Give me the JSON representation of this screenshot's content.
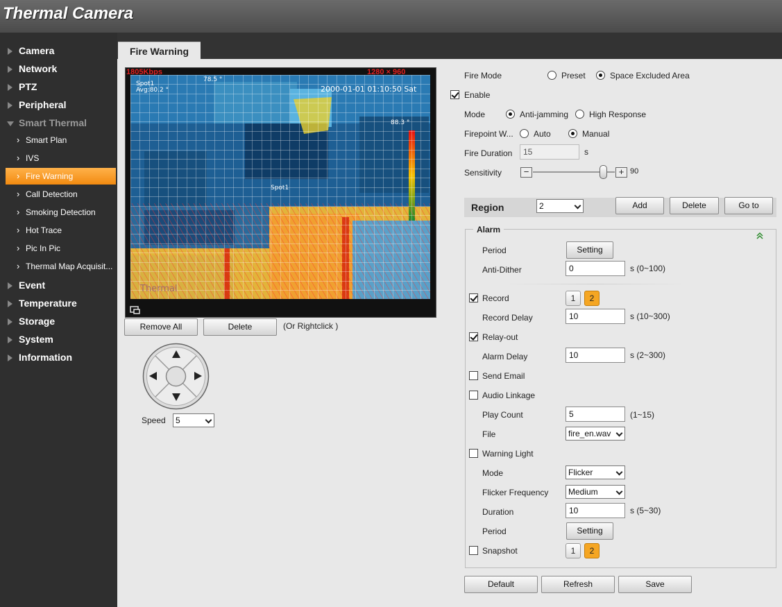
{
  "app": {
    "title": "Thermal Camera"
  },
  "sidebar": {
    "items": [
      {
        "label": "Camera"
      },
      {
        "label": "Network"
      },
      {
        "label": "PTZ"
      },
      {
        "label": "Peripheral"
      },
      {
        "label": "Smart Thermal"
      },
      {
        "label": "Event"
      },
      {
        "label": "Temperature"
      },
      {
        "label": "Storage"
      },
      {
        "label": "System"
      },
      {
        "label": "Information"
      }
    ],
    "sub_items": [
      {
        "label": "Smart Plan"
      },
      {
        "label": "IVS"
      },
      {
        "label": "Fire Warning"
      },
      {
        "label": "Call Detection"
      },
      {
        "label": "Smoking Detection"
      },
      {
        "label": "Hot Trace"
      },
      {
        "label": "Pic In Pic"
      },
      {
        "label": "Thermal Map Acquisit..."
      }
    ]
  },
  "tab": {
    "label": "Fire Warning"
  },
  "video": {
    "bitrate": "1805Kbps",
    "resolution": "1280 × 960",
    "datetime": "2000-01-01 01:10:50 Sat",
    "spot_label": "Spot1",
    "avg_label": "Avg:80.2 ° ",
    "temp_a": "78.5 °",
    "temp_b": "88.3 °",
    "spot_center": "Spot1",
    "watermark": "Thermal"
  },
  "video_controls": {
    "remove_all": "Remove All",
    "delete": "Delete",
    "hint": "(Or Rightclick )"
  },
  "ptz": {
    "speed_label": "Speed",
    "speed_value": "5"
  },
  "form": {
    "fire_mode_label": "Fire Mode",
    "fire_mode_options": [
      "Preset",
      "Space Excluded Area"
    ],
    "fire_mode_selected": "Space Excluded Area",
    "enable_label": "Enable",
    "enable": true,
    "mode_label": "Mode",
    "mode_options": [
      "Anti-jamming",
      "High Response"
    ],
    "mode_selected": "Anti-jamming",
    "firepoint_label": "Firepoint W...",
    "firepoint_options": [
      "Auto",
      "Manual"
    ],
    "firepoint_selected": "Manual",
    "duration_label": "Fire Duration",
    "duration_value": "15",
    "duration_unit": "s",
    "sensitivity_label": "Sensitivity",
    "sensitivity_value": "90",
    "region_label": "Region",
    "region_value": "2",
    "add": "Add",
    "delete": "Delete",
    "goto": "Go to"
  },
  "alarm": {
    "title": "Alarm",
    "period_label": "Period",
    "setting": "Setting",
    "antidither_label": "Anti-Dither",
    "antidither_value": "0",
    "antidither_range": "s (0~100)",
    "record_label": "Record",
    "record": true,
    "channels": [
      "1",
      "2"
    ],
    "record_delay_label": "Record Delay",
    "record_delay_value": "10",
    "record_delay_range": "s (10~300)",
    "relay_label": "Relay-out",
    "relay": true,
    "alarm_delay_label": "Alarm Delay",
    "alarm_delay_value": "10",
    "alarm_delay_range": "s (2~300)",
    "email_label": "Send Email",
    "email": false,
    "audio_label": "Audio Linkage",
    "audio": false,
    "play_count_label": "Play Count",
    "play_count_value": "5",
    "play_count_range": "(1~15)",
    "file_label": "File",
    "file_value": "fire_en.wav",
    "light_label": "Warning Light",
    "light": false,
    "light_mode_label": "Mode",
    "light_mode_value": "Flicker",
    "flicker_label": "Flicker Frequency",
    "flicker_value": "Medium",
    "light_duration_label": "Duration",
    "light_duration_value": "10",
    "light_duration_range": "s (5~30)",
    "light_period_label": "Period",
    "snapshot_label": "Snapshot",
    "snapshot": false
  },
  "footer": {
    "default": "Default",
    "refresh": "Refresh",
    "save": "Save"
  }
}
